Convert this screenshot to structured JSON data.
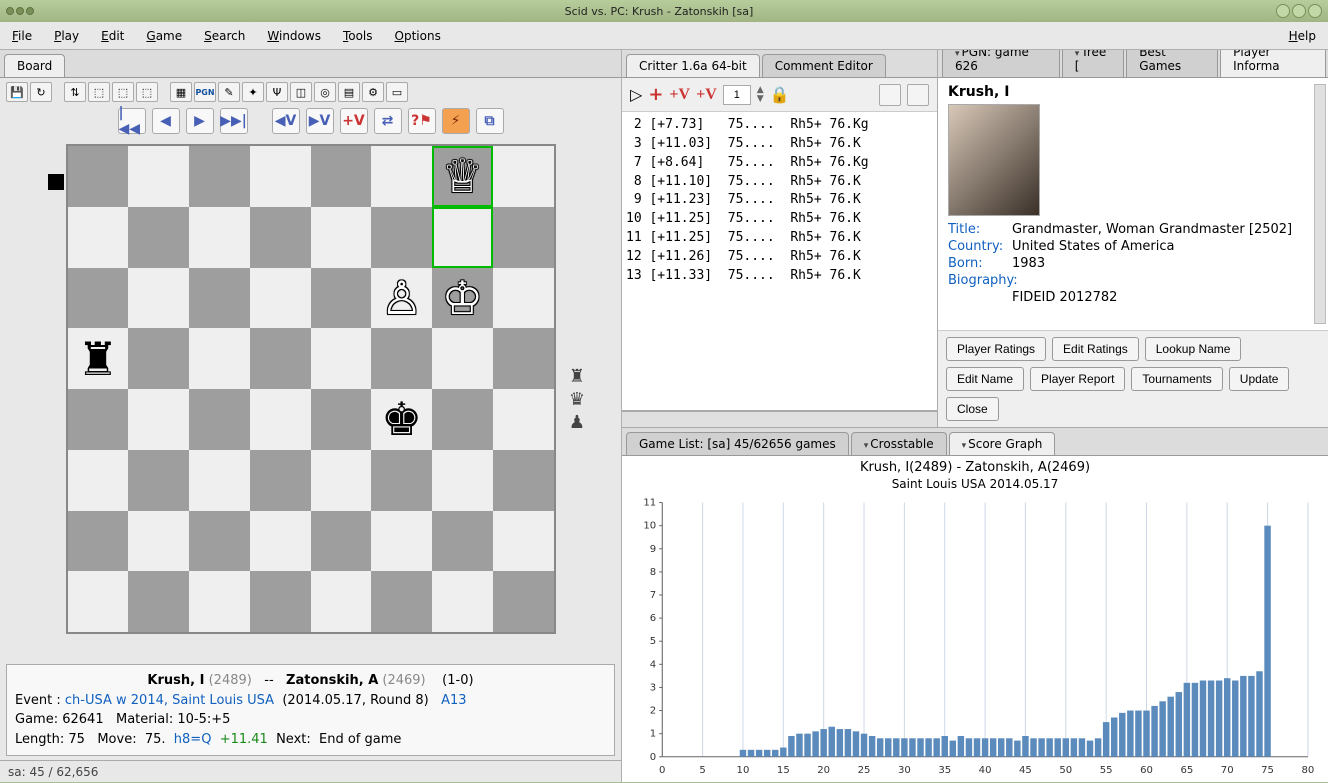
{
  "window": {
    "title": "Scid vs. PC: Krush - Zatonskih [sa]"
  },
  "menu": [
    "File",
    "Play",
    "Edit",
    "Game",
    "Search",
    "Windows",
    "Tools",
    "Options",
    "Help"
  ],
  "left_tab": "Board",
  "toolbar_icons": [
    "save",
    "reload",
    "|",
    "flip",
    "prev-var",
    "next-var",
    "exit-var",
    "|",
    "db",
    "pgn",
    "notes",
    "annotate",
    "tree",
    "graph",
    "tablebase",
    "book",
    "engine"
  ],
  "nav": {
    "start": "|◀◀",
    "back": "◀",
    "fwd": "▶",
    "end": "▶▶|",
    "vback": "◀V",
    "vfwd": "▶V",
    "vplus": "+V",
    "swap": "⇄",
    "threat": "?⚑",
    "eng": "⚙"
  },
  "board": {
    "pieces": [
      {
        "sq": "g8",
        "p": "♕",
        "c": "w",
        "hilite": true
      },
      {
        "sq": "g7",
        "p": "",
        "c": "",
        "hilite": true
      },
      {
        "sq": "f6",
        "p": "♙",
        "c": "w"
      },
      {
        "sq": "g6",
        "p": "♔",
        "c": "w"
      },
      {
        "sq": "a5",
        "p": "♜",
        "c": "b"
      },
      {
        "sq": "f4",
        "p": "♚",
        "c": "b"
      }
    ],
    "captured": [
      "♜",
      "♛",
      "♟"
    ]
  },
  "gameinfo": {
    "white": "Krush, I",
    "wrating": "(2489)",
    "sep": "--",
    "black": "Zatonskih, A",
    "brating": "(2469)",
    "result": "(1-0)",
    "event_lbl": "Event :",
    "event": "ch-USA w 2014, Saint Louis USA",
    "dateround": "(2014.05.17, Round 8)",
    "eco": "A13",
    "game_lbl": "Game:",
    "gnum": "62641",
    "mat_lbl": "Material:",
    "mat": "10-5:+5",
    "len_lbl": "Length:",
    "len": "75",
    "move_lbl": "Move:",
    "move": "75.",
    "san": "h8=Q",
    "eval": "+11.41",
    "next_lbl": "Next:",
    "next": "End of game"
  },
  "status": "sa:  45 / 62,656",
  "engine": {
    "tabs": [
      "Critter 1.6a 64-bit",
      "Comment Editor"
    ],
    "spin": "1",
    "lines": [
      {
        "n": "2",
        "eval": "[+7.73]",
        "mv": "75....  Rh5+ 76.Kg"
      },
      {
        "n": "3",
        "eval": "[+11.03]",
        "mv": "75....  Rh5+ 76.K"
      },
      {
        "n": "7",
        "eval": "[+8.64]",
        "mv": "75....  Rh5+ 76.Kg"
      },
      {
        "n": "8",
        "eval": "[+11.10]",
        "mv": "75....  Rh5+ 76.K"
      },
      {
        "n": "9",
        "eval": "[+11.23]",
        "mv": "75....  Rh5+ 76.K"
      },
      {
        "n": "10",
        "eval": "[+11.25]",
        "mv": "75....  Rh5+ 76.K"
      },
      {
        "n": "11",
        "eval": "[+11.25]",
        "mv": "75....  Rh5+ 76.K"
      },
      {
        "n": "12",
        "eval": "[+11.26]",
        "mv": "75....  Rh5+ 76.K"
      },
      {
        "n": "13",
        "eval": "[+11.33]",
        "mv": "75....  Rh5+ 76.K"
      }
    ]
  },
  "player_tabs": [
    "PGN: game 626",
    "Tree [",
    "Best Games",
    "Player Informa"
  ],
  "player": {
    "name": "Krush, I",
    "title_lbl": "Title:",
    "title": "Grandmaster,  Woman Grandmaster  [2502]",
    "country_lbl": "Country:",
    "country": "United States of America",
    "born_lbl": "Born:",
    "born": "1983",
    "bio_lbl": "Biography:",
    "fideid": "FIDEID 2012782",
    "buttons": [
      "Player Ratings",
      "Edit Ratings",
      "Lookup Name",
      "Edit Name",
      "Player Report",
      "Tournaments",
      "Update",
      "Close"
    ]
  },
  "lower_tabs": [
    "Game List: [sa] 45/62656 games",
    "Crosstable",
    "Score Graph"
  ],
  "chart": {
    "title": "Krush, I(2489) - Zatonskih, A(2469)",
    "subtitle": "Saint Louis USA  2014.05.17"
  },
  "chart_data": {
    "type": "bar",
    "title": "Krush, I(2489) - Zatonskih, A(2469)",
    "xlabel": "",
    "ylabel": "",
    "ylim": [
      0,
      11
    ],
    "xlim": [
      0,
      80
    ],
    "x": [
      10,
      11,
      12,
      13,
      14,
      15,
      16,
      17,
      18,
      19,
      20,
      21,
      22,
      23,
      24,
      25,
      26,
      27,
      28,
      29,
      30,
      31,
      32,
      33,
      34,
      35,
      36,
      37,
      38,
      39,
      40,
      41,
      42,
      43,
      44,
      45,
      46,
      47,
      48,
      49,
      50,
      51,
      52,
      53,
      54,
      55,
      56,
      57,
      58,
      59,
      60,
      61,
      62,
      63,
      64,
      65,
      66,
      67,
      68,
      69,
      70,
      71,
      72,
      73,
      74,
      75
    ],
    "values": [
      0.3,
      0.3,
      0.3,
      0.3,
      0.3,
      0.4,
      0.9,
      1.0,
      1.0,
      1.1,
      1.2,
      1.3,
      1.2,
      1.2,
      1.1,
      1.0,
      0.9,
      0.8,
      0.8,
      0.8,
      0.8,
      0.8,
      0.8,
      0.8,
      0.8,
      0.9,
      0.7,
      0.9,
      0.8,
      0.8,
      0.8,
      0.8,
      0.8,
      0.8,
      0.7,
      0.9,
      0.8,
      0.8,
      0.8,
      0.8,
      0.8,
      0.8,
      0.8,
      0.7,
      0.8,
      1.5,
      1.7,
      1.9,
      2.0,
      2.0,
      2.0,
      2.2,
      2.4,
      2.6,
      2.8,
      3.2,
      3.2,
      3.3,
      3.3,
      3.3,
      3.4,
      3.3,
      3.5,
      3.5,
      3.7,
      10.0
    ]
  }
}
